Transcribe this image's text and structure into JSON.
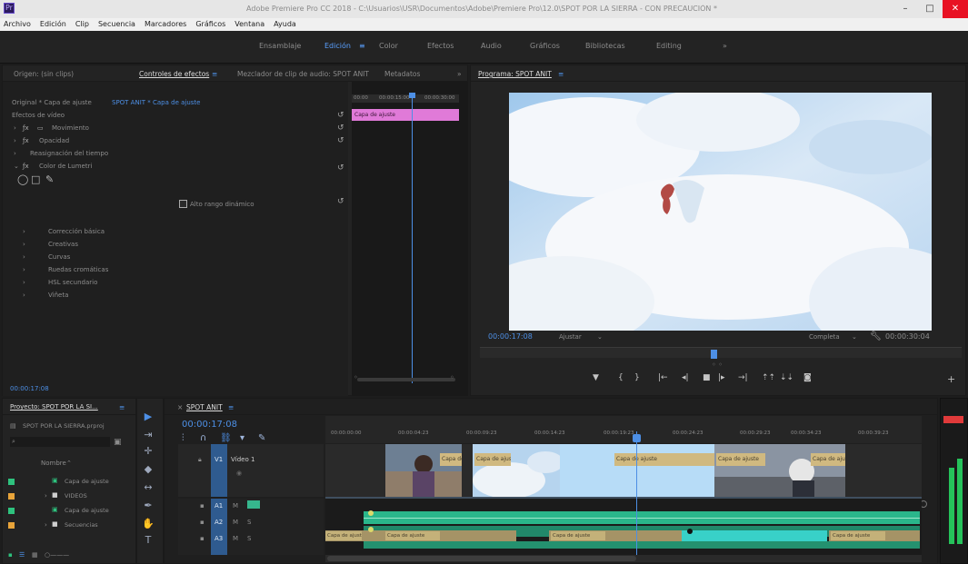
{
  "window": {
    "title": "Adobe Premiere Pro CC 2018 - C:\\Usuarios\\USR\\Documentos\\Adobe\\Premiere Pro\\12.0\\SPOT POR LA SIERRA - CON PRECAUCIÓN *",
    "minimize": "–",
    "maximize": "□",
    "close": "✕"
  },
  "menu": [
    "Archivo",
    "Edición",
    "Clip",
    "Secuencia",
    "Marcadores",
    "Gráficos",
    "Ventana",
    "Ayuda"
  ],
  "workspaces": [
    "Ensamblaje",
    "Edición",
    "Color",
    "Efectos",
    "Audio",
    "Gráficos",
    "Bibliotecas",
    "Editing",
    "»"
  ],
  "active_workspace": "Edición",
  "effect_controls": {
    "tabs": [
      "Origen: (sin clips)",
      "Controles de efectos",
      "Mezclador de clip de audio: SPOT ANIT",
      "Metadatos"
    ],
    "active_tab": "Controles de efectos",
    "source_label": "Original * Capa de ajuste",
    "target_label": "SPOT ANIT * Capa de ajuste",
    "section": "Efectos de vídeo",
    "effects": [
      "Movimiento",
      "Opacidad",
      "Reasignación del tiempo",
      "Color de Lumetri"
    ],
    "checkbox_label": "Alto rango dinámico",
    "lumetri_items": [
      "Corrección básica",
      "Creativas",
      "Curvas",
      "Ruedas cromáticas",
      "HSL secundario",
      "Viñeta"
    ],
    "mini_times": [
      "00:00",
      "00:00:15:00",
      "00:00:30:00"
    ],
    "clip_label": "Capa de ajuste",
    "timecode": "00:00:17:08"
  },
  "program": {
    "tab": "Programa: SPOT ANIT",
    "timecode": "00:00:17:08",
    "fit": "Ajustar",
    "quality": "Completa",
    "duration": "00:00:30:04"
  },
  "project": {
    "tab": "Proyecto: SPOT POR LA SI...",
    "file": "SPOT POR LA SIERRA.prproj",
    "column": "Nombre",
    "items": [
      "Capa de ajuste",
      "VIDEOS",
      "Capa de ajuste",
      "Secuencias"
    ],
    "item_colors": [
      "#2ec27e",
      "#e8a43a",
      "#2ec27e",
      "#e8a43a"
    ]
  },
  "timeline": {
    "tab": "SPOT ANIT",
    "timecode": "00:00:17:08",
    "ruler": [
      "00:00:00:00",
      "00:00:04:23",
      "00:00:09:23",
      "00:00:14:23",
      "00:00:19:23",
      "00:00:24:23",
      "00:00:29:23",
      "00:00:34:23",
      "00:00:39:23"
    ],
    "video_track": "Vídeo 1",
    "audio_tracks": [
      "A1",
      "A2",
      "A3"
    ],
    "clip_tags": [
      "Capa de ajuste",
      "Capa de ajuste",
      "Capa de ajuste",
      "Capa de ajuste",
      "Capa de ajuste"
    ],
    "audio_tags": [
      "Capa de ajuste",
      "Capa de ajuste",
      "Capa de ajuste",
      "Capa de ajuste"
    ],
    "track_letters": [
      "V1",
      "M",
      "S"
    ]
  },
  "colors": {
    "accent": "#4d8fe5",
    "playhead": "#4d8fe5",
    "audio": "#2ab68b",
    "clip_label": "#d0b980",
    "adjustment_clip": "#e07ad8",
    "close_button": "#e81123"
  }
}
